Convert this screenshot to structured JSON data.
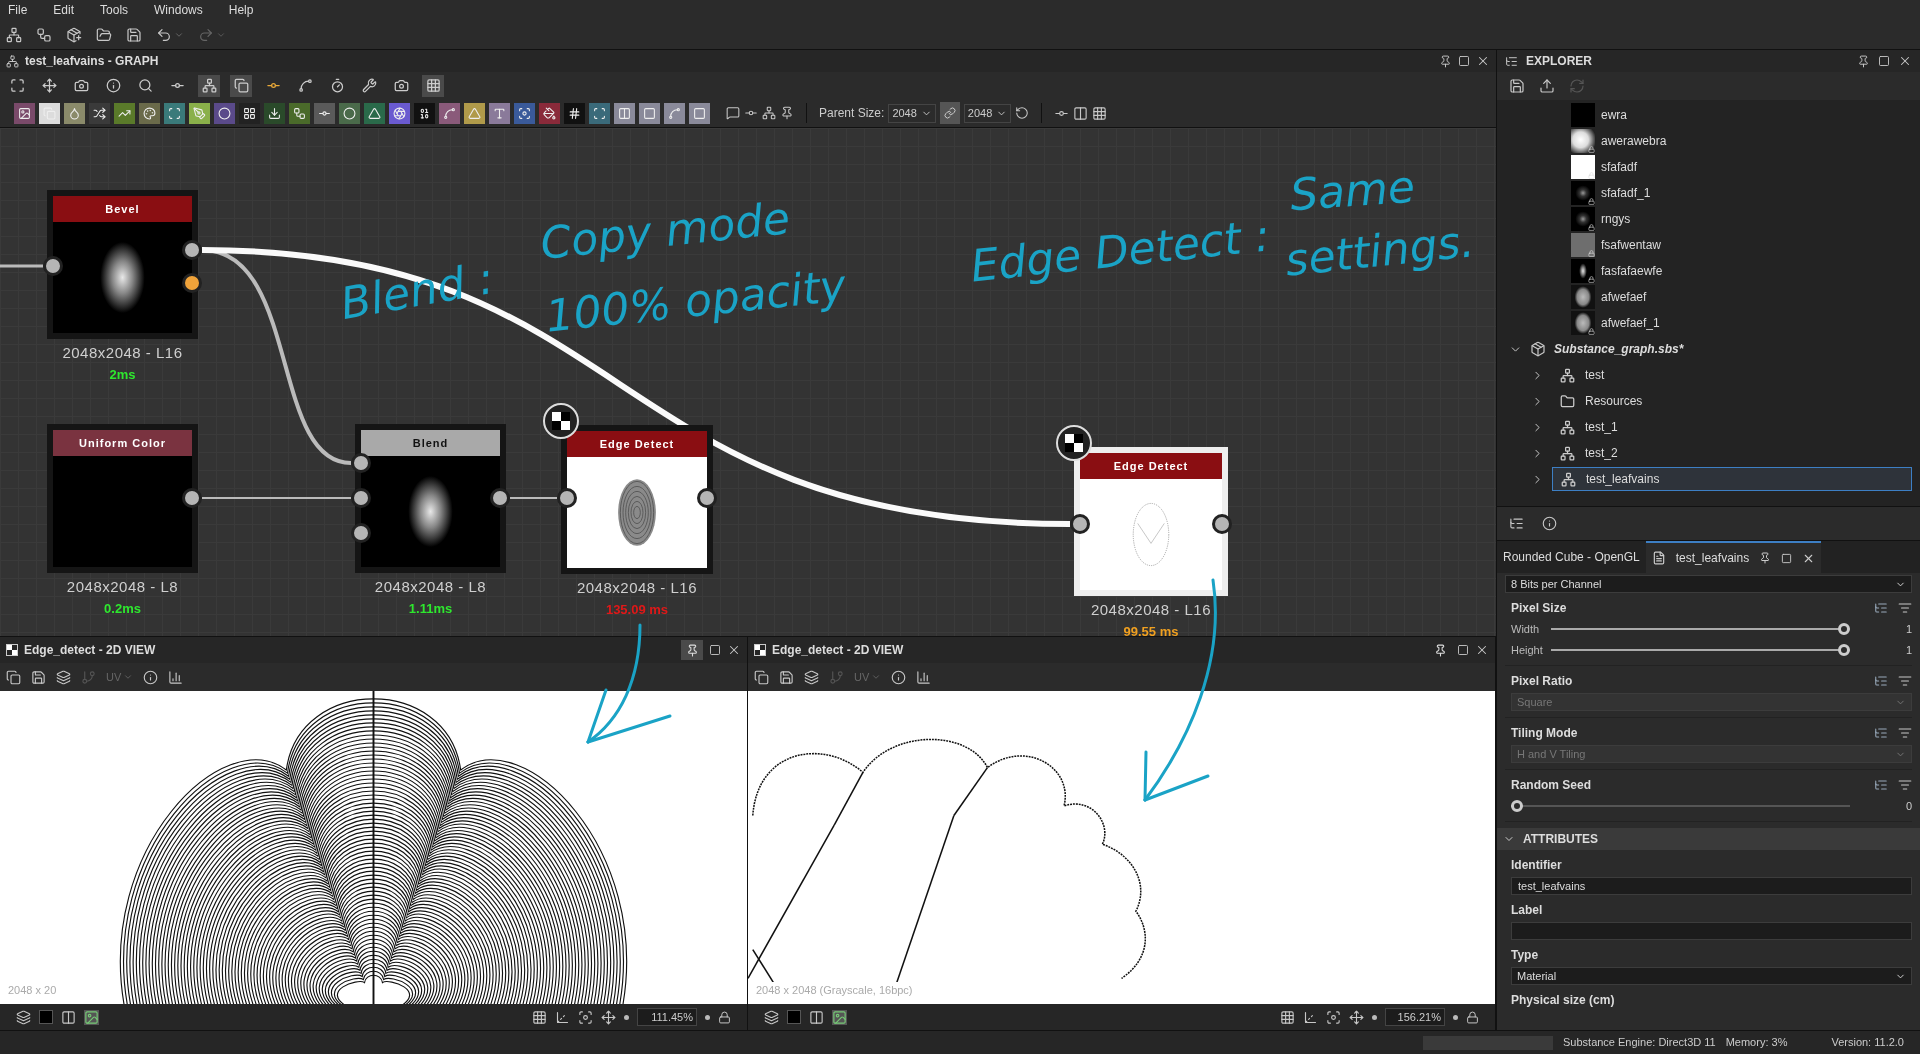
{
  "menu": [
    "File",
    "Edit",
    "Tools",
    "Windows",
    "Help"
  ],
  "graph": {
    "title": "test_leafvains - GRAPH",
    "parent_size_label": "Parent Size:",
    "parent_size": "2048",
    "size_linked": true,
    "size": "2048",
    "nodes": [
      {
        "title": "Bevel",
        "kind": "filter",
        "resolution": "2048x2048 - L16",
        "time": "2ms",
        "color": "#2ee82e",
        "selected": false
      },
      {
        "title": "Uniform Color",
        "kind": "generator",
        "resolution": "2048x2048 - L8",
        "time": "0.2ms",
        "color": "#2ee82e",
        "selected": false
      },
      {
        "title": "Blend",
        "kind": "blend",
        "resolution": "2048x2048 - L8",
        "time": "1.11ms",
        "color": "#2ee82e",
        "selected": false
      },
      {
        "title": "Edge Detect",
        "kind": "filter",
        "resolution": "2048x2048 - L16",
        "time": "135.09 ms",
        "color": "#e01818",
        "selected": false
      },
      {
        "title": "Edge Detect",
        "kind": "filter",
        "resolution": "2048x2048 - L16",
        "time": "99.55 ms",
        "color": "#f0a020",
        "selected": true
      }
    ],
    "annotations": [
      "Blend :",
      "Copy mode",
      "100% opacity",
      "Edge Detect :",
      "Same",
      "settings."
    ]
  },
  "views": [
    {
      "title": "Edge_detect - 2D VIEW",
      "pinned": true,
      "channel": "UV",
      "info": "2048 x 20",
      "zoom": "111.45%"
    },
    {
      "title": "Edge_detect - 2D VIEW",
      "pinned": false,
      "channel": "UV",
      "info": "2048 x 2048 (Grayscale, 16bpc)",
      "zoom": "156.21%"
    }
  ],
  "explorer": {
    "title": "EXPLORER",
    "resources": [
      {
        "label": "ewra",
        "locked": false
      },
      {
        "label": "awerawebra",
        "locked": true
      },
      {
        "label": "sfafadf",
        "locked": true
      },
      {
        "label": "sfafadf_1",
        "locked": true
      },
      {
        "label": "rngys",
        "locked": true
      },
      {
        "label": "fsafwentaw",
        "locked": true
      },
      {
        "label": "fasfafaewfe",
        "locked": true
      },
      {
        "label": "afwefaef",
        "locked": false
      },
      {
        "label": "afwefaef_1",
        "locked": true
      }
    ],
    "package": {
      "label": "Substance_graph.sbs*",
      "expanded": true,
      "children": [
        {
          "label": "test",
          "kind": "graph",
          "expanded": false,
          "selected": false
        },
        {
          "label": "Resources",
          "kind": "folder",
          "expanded": false,
          "selected": false
        },
        {
          "label": "test_1",
          "kind": "graph",
          "expanded": false,
          "selected": false
        },
        {
          "label": "test_2",
          "kind": "graph",
          "expanded": false,
          "selected": false
        },
        {
          "label": "test_leafvains",
          "kind": "graph",
          "expanded": false,
          "selected": true
        }
      ]
    }
  },
  "properties": {
    "tabs": [
      {
        "label": "Rounded Cube - OpenGL",
        "selected": false
      },
      {
        "label": "test_leafvains",
        "selected": true
      }
    ],
    "format": "8 Bits per Channel",
    "groups": [
      {
        "title": "Pixel Size",
        "kind": "sliders",
        "sliders": [
          {
            "label": "Width",
            "level": 1,
            "value": "1"
          },
          {
            "label": "Height",
            "level": 1,
            "value": "1"
          }
        ]
      },
      {
        "title": "Pixel Ratio",
        "kind": "dropdown",
        "value": "Square",
        "disabled": true
      },
      {
        "title": "Tiling Mode",
        "kind": "dropdown",
        "value": "H and V Tiling",
        "disabled": true
      },
      {
        "title": "Random Seed",
        "kind": "sliders",
        "sliders": [
          {
            "level": 0,
            "value": "0"
          }
        ]
      }
    ],
    "attributes": {
      "title": "ATTRIBUTES",
      "expanded": true,
      "fields": [
        {
          "label": "Identifier",
          "kind": "text",
          "value": "test_leafvains"
        },
        {
          "label": "Label",
          "kind": "text"
        },
        {
          "label": "Type",
          "kind": "dropdown",
          "value": "Material"
        },
        {
          "label": "Physical size (cm)",
          "kind": "heading"
        }
      ]
    }
  },
  "status": {
    "engine": "Substance Engine: Direct3D 11",
    "memory": "Memory: 3%",
    "version": "Version: 11.2.0"
  }
}
